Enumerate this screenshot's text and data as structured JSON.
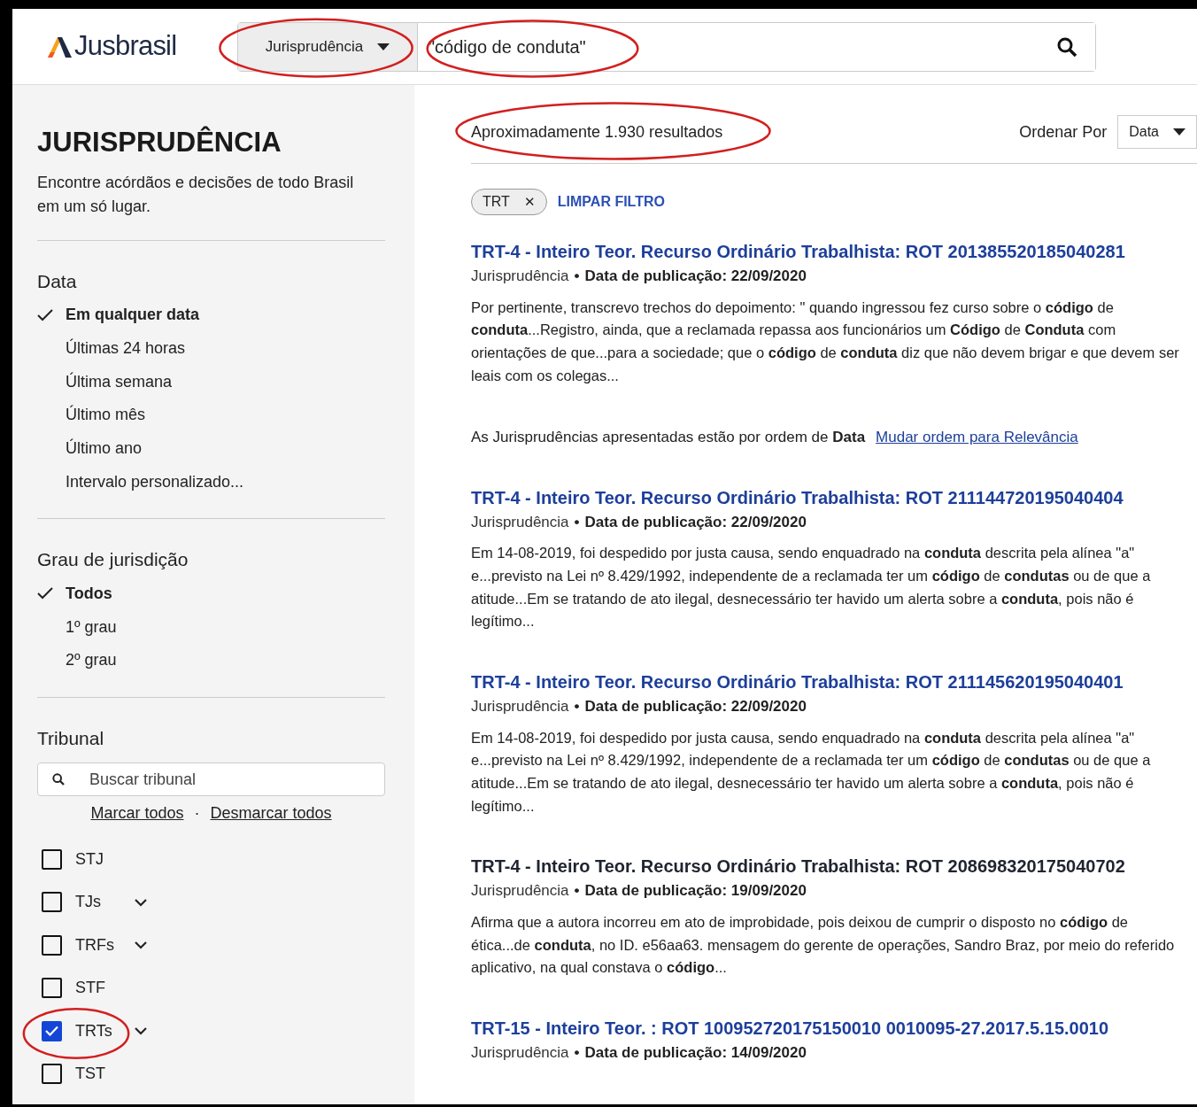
{
  "header": {
    "logo": "Jusbrasil",
    "category": {
      "label": "Jurisprudência",
      "highlighted": true
    },
    "search": {
      "value": "\"código de conduta\"",
      "highlighted": true
    }
  },
  "sidebar": {
    "title": "JURISPRUDÊNCIA",
    "description": "Encontre acórdãos e decisões de todo Brasil em um só lugar.",
    "date_filter": {
      "heading": "Data",
      "options": [
        {
          "label": "Em qualquer data",
          "selected": true
        },
        {
          "label": "Últimas 24 horas",
          "selected": false
        },
        {
          "label": "Última semana",
          "selected": false
        },
        {
          "label": "Último mês",
          "selected": false
        },
        {
          "label": "Último ano",
          "selected": false
        },
        {
          "label": "Intervalo personalizado...",
          "selected": false
        }
      ]
    },
    "degree_filter": {
      "heading": "Grau de jurisdição",
      "options": [
        {
          "label": "Todos",
          "selected": true
        },
        {
          "label": "1º grau",
          "selected": false
        },
        {
          "label": "2º grau",
          "selected": false
        }
      ]
    },
    "court_filter": {
      "heading": "Tribunal",
      "search_placeholder": "Buscar tribunal",
      "links": [
        "Marcar todos",
        "Desmarcar todos"
      ],
      "separator": "·",
      "courts": [
        {
          "label": "STJ",
          "checked": false,
          "expandable": false,
          "highlighted": false
        },
        {
          "label": "TJs",
          "checked": false,
          "expandable": true,
          "highlighted": false
        },
        {
          "label": "TRFs",
          "checked": false,
          "expandable": true,
          "highlighted": false
        },
        {
          "label": "STF",
          "checked": false,
          "expandable": false,
          "highlighted": false
        },
        {
          "label": "TRTs",
          "checked": true,
          "expandable": true,
          "highlighted": true
        },
        {
          "label": "TST",
          "checked": false,
          "expandable": false,
          "highlighted": false
        }
      ]
    }
  },
  "results": {
    "count": {
      "text": "Aproximadamente 1.930 resultados",
      "highlighted": true
    },
    "sort_label": "Ordenar Por",
    "sort_value": "Data",
    "filter_chip": {
      "label": "TRT",
      "close": "✕"
    },
    "clear_filter": "LIMPAR FILTRO",
    "items": [
      {
        "kind": "result",
        "title": "TRT-4 - Inteiro Teor. Recurso Ordinário Trabalhista: ROT 201385520185040281",
        "visited": false,
        "type": "Jurisprudência",
        "separator": "•",
        "date": "Data de publicação: 22/09/2020",
        "snippet": "Por pertinente, transcrevo trechos do depoimento: \" quando ingressou fez curso sobre o **código** de **conduta**...Registro, ainda, que a reclamada repassa aos funcionários um **Código** de **Conduta** com orientações de que...para a sociedade; que o **código** de **conduta** diz que não devem brigar e que devem ser leais com os colegas..."
      },
      {
        "kind": "notice",
        "text": "As Jurisprudências apresentadas estão por ordem de **Data**",
        "link": "Mudar ordem para Relevância"
      },
      {
        "kind": "result",
        "title": "TRT-4 - Inteiro Teor. Recurso Ordinário Trabalhista: ROT 211144720195040404",
        "visited": false,
        "type": "Jurisprudência",
        "separator": "•",
        "date": "Data de publicação: 22/09/2020",
        "snippet": "Em 14-08-2019, foi despedido por justa causa, sendo enquadrado na **conduta** descrita pela alínea \"a\" e...previsto na Lei nº 8.429/1992, independente de a reclamada ter um **código** de **condutas** ou de que a atitude...Em se tratando de ato ilegal, desnecessário ter havido um alerta sobre a **conduta**, pois não é legítimo..."
      },
      {
        "kind": "result",
        "title": "TRT-4 - Inteiro Teor. Recurso Ordinário Trabalhista: ROT 211145620195040401",
        "visited": false,
        "type": "Jurisprudência",
        "separator": "•",
        "date": "Data de publicação: 22/09/2020",
        "snippet": "Em 14-08-2019, foi despedido por justa causa, sendo enquadrado na **conduta** descrita pela alínea \"a\" e...previsto na Lei nº 8.429/1992, independente de a reclamada ter um **código** de **condutas** ou de que a atitude...Em se tratando de ato ilegal, desnecessário ter havido um alerta sobre a **conduta**, pois não é legítimo..."
      },
      {
        "kind": "result",
        "title": "TRT-4 - Inteiro Teor. Recurso Ordinário Trabalhista: ROT 208698320175040702",
        "visited": true,
        "type": "Jurisprudência",
        "separator": "•",
        "date": "Data de publicação: 19/09/2020",
        "snippet": "Afirma que a autora incorreu em ato de improbidade, pois deixou de cumprir o disposto no **código** de ética...de **conduta**, no ID. e56aa63. mensagem do gerente de operações, Sandro Braz, por meio do referido aplicativo, na qual constava o **código**..."
      },
      {
        "kind": "result",
        "title": "TRT-15 - Inteiro Teor. : ROT 100952720175150010 0010095-27.2017.5.15.0010",
        "visited": false,
        "type": "Jurisprudência",
        "separator": "•",
        "date": "Data de publicação: 14/09/2020"
      }
    ]
  }
}
